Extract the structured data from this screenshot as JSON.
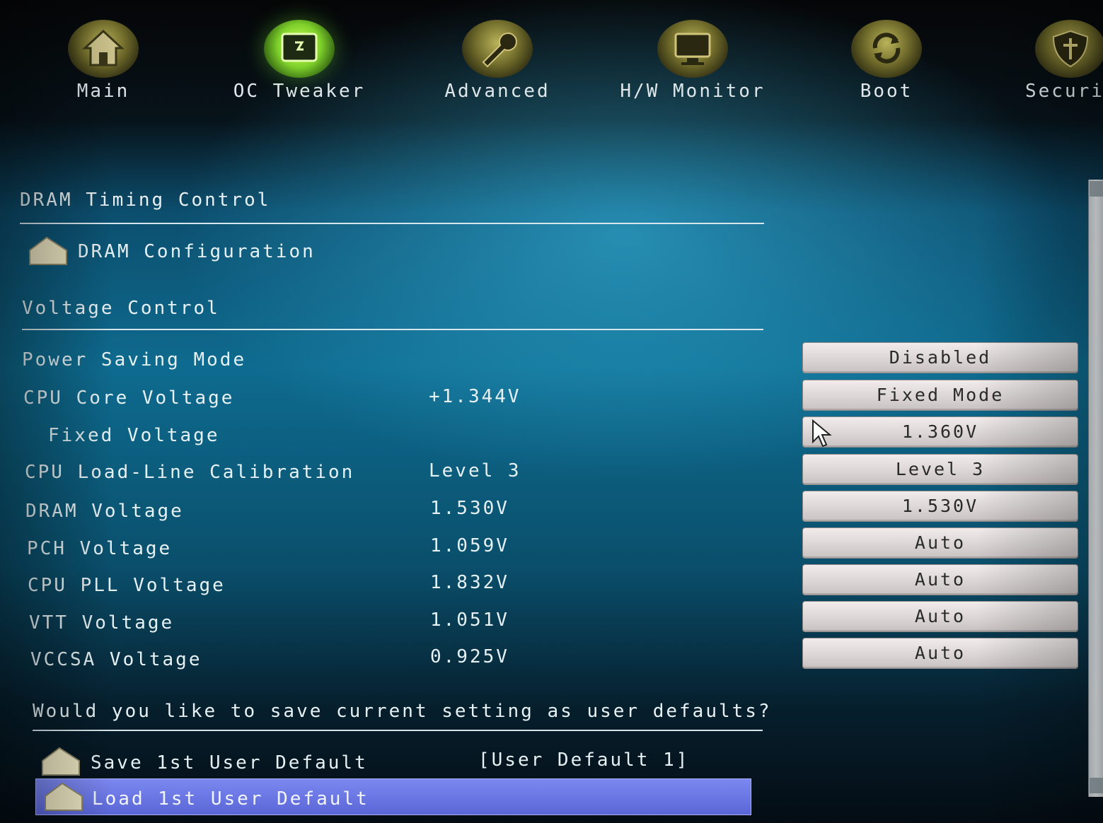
{
  "tabs": [
    {
      "label": "Main",
      "icon": "home-icon"
    },
    {
      "label": "OC Tweaker",
      "icon": "oc-tweaker-icon"
    },
    {
      "label": "Advanced",
      "icon": "wrench-icon"
    },
    {
      "label": "H/W Monitor",
      "icon": "monitor-icon"
    },
    {
      "label": "Boot",
      "icon": "boot-refresh-icon"
    },
    {
      "label": "Securi",
      "icon": "shield-icon"
    }
  ],
  "active_tab": "OC Tweaker",
  "sections": {
    "dram_timing": "DRAM Timing Control",
    "dram_config": "DRAM Configuration",
    "voltage": "Voltage Control",
    "user_defaults_prompt": "Would you like to save current setting as user defaults?"
  },
  "voltage_rows": [
    {
      "label": "Power Saving Mode",
      "current": "",
      "setting": "Disabled"
    },
    {
      "label": "CPU Core Voltage",
      "current": "+1.344V",
      "setting": "Fixed Mode"
    },
    {
      "label": "Fixed Voltage",
      "current": "",
      "setting": "1.360V"
    },
    {
      "label": "CPU Load-Line Calibration",
      "current": "Level 3",
      "setting": "Level 3"
    },
    {
      "label": "DRAM Voltage",
      "current": "1.530V",
      "setting": "1.530V"
    },
    {
      "label": "PCH Voltage",
      "current": "1.059V",
      "setting": "Auto"
    },
    {
      "label": "CPU PLL Voltage",
      "current": "1.832V",
      "setting": "Auto"
    },
    {
      "label": "VTT Voltage",
      "current": "1.051V",
      "setting": "Auto"
    },
    {
      "label": "VCCSA Voltage",
      "current": "0.925V",
      "setting": "Auto"
    }
  ],
  "user_default_items": [
    {
      "label": "Save 1st User Default",
      "value": "[User Default 1]"
    },
    {
      "label": "Load 1st User Default",
      "value": ""
    }
  ],
  "colors": {
    "accent_selected": "#5a66d6",
    "text": "#e6f1f4",
    "field_bg": "#d9d3d3"
  }
}
